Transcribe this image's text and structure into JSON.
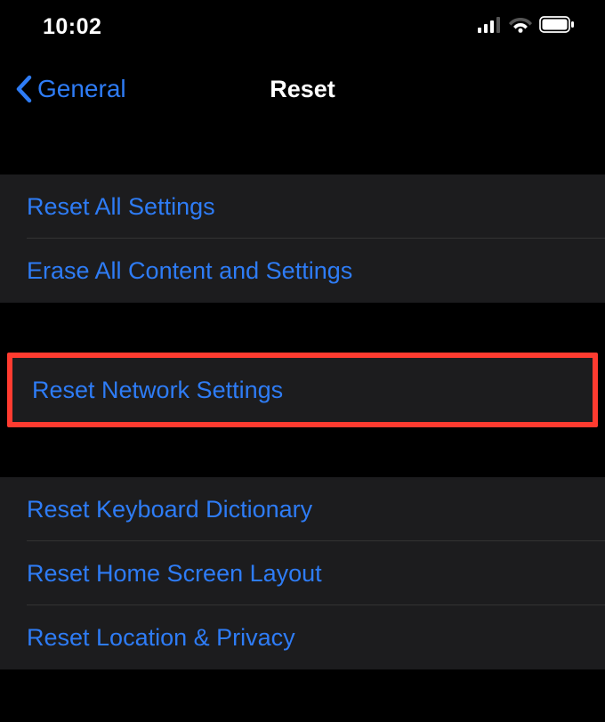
{
  "statusBar": {
    "time": "10:02"
  },
  "nav": {
    "backLabel": "General",
    "title": "Reset"
  },
  "group1": {
    "items": [
      {
        "label": "Reset All Settings"
      },
      {
        "label": "Erase All Content and Settings"
      }
    ]
  },
  "group2": {
    "items": [
      {
        "label": "Reset Network Settings"
      }
    ]
  },
  "group3": {
    "items": [
      {
        "label": "Reset Keyboard Dictionary"
      },
      {
        "label": "Reset Home Screen Layout"
      },
      {
        "label": "Reset Location & Privacy"
      }
    ]
  }
}
